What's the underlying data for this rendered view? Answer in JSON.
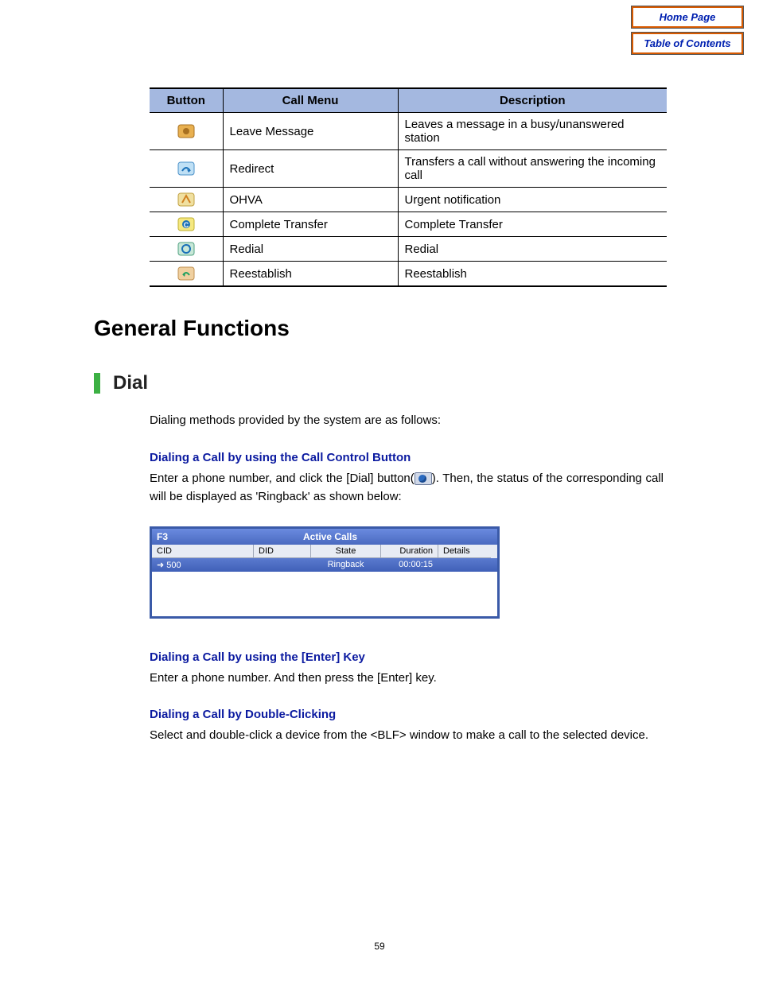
{
  "nav": {
    "home": "Home Page",
    "toc": "Table of Contents"
  },
  "table": {
    "headers": {
      "button": "Button",
      "menu": "Call Menu",
      "desc": "Description"
    },
    "rows": [
      {
        "icon": "leave-message-icon",
        "menu": "Leave Message",
        "desc": "Leaves a message in a busy/unanswered station"
      },
      {
        "icon": "redirect-icon",
        "menu": "Redirect",
        "desc": "Transfers a call without answering the incoming call"
      },
      {
        "icon": "ohva-icon",
        "menu": "OHVA",
        "desc": "Urgent notification"
      },
      {
        "icon": "complete-transfer-icon",
        "menu": "Complete Transfer",
        "desc": "Complete Transfer"
      },
      {
        "icon": "redial-icon",
        "menu": "Redial",
        "desc": "Redial"
      },
      {
        "icon": "reestablish-icon",
        "menu": "Reestablish",
        "desc": "Reestablish"
      }
    ]
  },
  "headings": {
    "h1": "General Functions",
    "h2": "Dial"
  },
  "intro": "Dialing methods provided by the system are as follows:",
  "s1": {
    "title": "Dialing a Call by using the Call Control Button",
    "text_a": "Enter a phone number, and click the [Dial] button(",
    "text_b": "). Then, the status of the corresponding call will be displayed as 'Ringback' as shown below:"
  },
  "active_calls": {
    "left_label": "F3",
    "title": "Active Calls",
    "cols": {
      "cid": "CID",
      "did": "DID",
      "state": "State",
      "duration": "Duration",
      "details": "Details"
    },
    "row": {
      "cid": "500",
      "did": "",
      "state": "Ringback",
      "duration": "00:00:15",
      "details": ""
    }
  },
  "s2": {
    "title": "Dialing a Call by using the [Enter] Key",
    "text": "Enter a phone number. And then press the [Enter] key."
  },
  "s3": {
    "title": "Dialing a Call by Double-Clicking",
    "text": "Select and double-click a device from the <BLF> window to make a call to the selected device."
  },
  "page_number": "59"
}
